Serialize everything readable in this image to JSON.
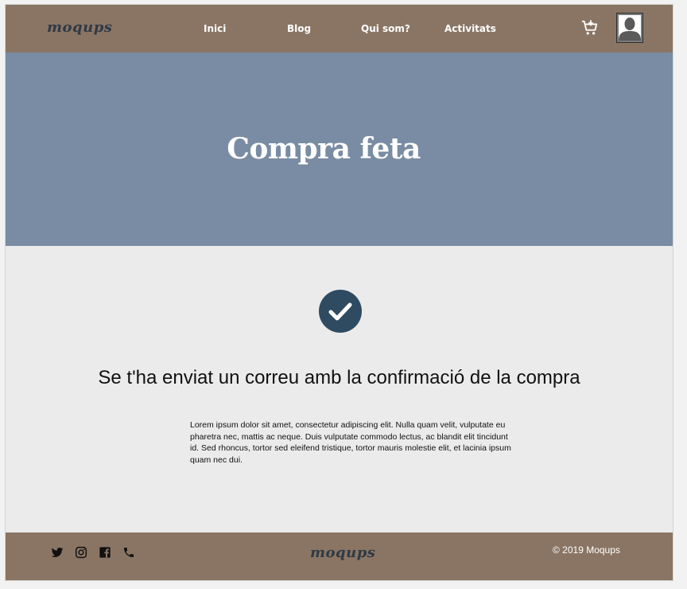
{
  "header": {
    "logo": "moqups",
    "nav": [
      "Inici",
      "Blog",
      "Qui som?",
      "Activitats"
    ]
  },
  "hero": {
    "title": "Compra feta"
  },
  "content": {
    "message": "Se t'ha enviat un correu amb la confirmació de la compra",
    "body": "Lorem ipsum dolor sit amet, consectetur adipiscing elit. Nulla quam velit, vulputate eu pharetra nec, mattis ac neque. Duis vulputate commodo lectus, ac blandit elit tincidunt id. Sed rhoncus, tortor sed eleifend tristique, tortor mauris molestie elit, et lacinia ipsum quam nec dui."
  },
  "footer": {
    "logo": "moqups",
    "copyright": "© 2019  Moqups",
    "social_icons": [
      "twitter-icon",
      "instagram-icon",
      "facebook-icon",
      "phone-icon"
    ]
  },
  "colors": {
    "header_bg": "#8a7564",
    "hero_bg": "#798ca3",
    "content_bg": "#ebebeb",
    "check_bg": "#2f4b61",
    "logo": "#2f3a45"
  }
}
